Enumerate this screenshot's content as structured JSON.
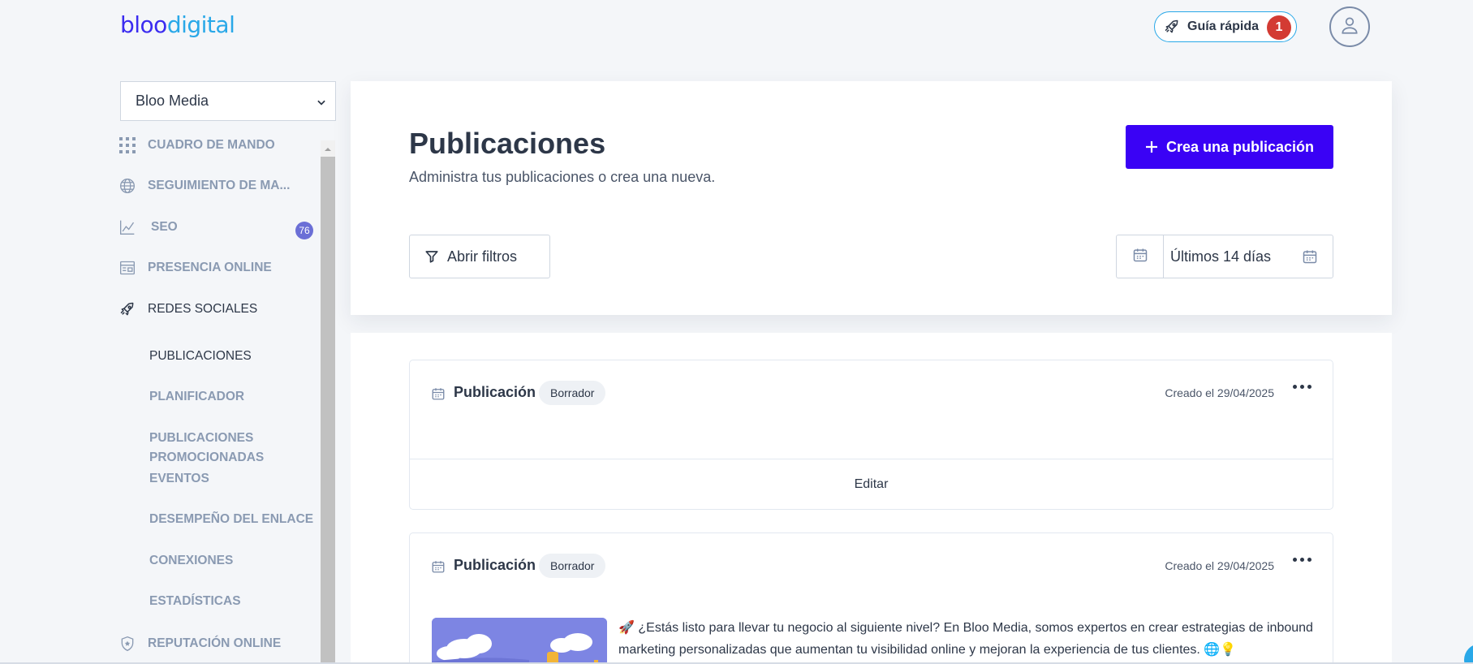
{
  "logo": {
    "part1": "bloo",
    "part2": "digital"
  },
  "topbar": {
    "guide_label": "Guía rápida",
    "guide_badge": "1",
    "avatar_icon": "user-icon"
  },
  "sidebar": {
    "account": "Bloo Media",
    "items": [
      {
        "label": "CUADRO DE MANDO",
        "icon": "grid-icon"
      },
      {
        "label": "SEGUIMIENTO DE MA...",
        "icon": "globe-icon"
      },
      {
        "label": "SEO",
        "icon": "chart-line-icon",
        "badge": "76"
      },
      {
        "label": "PRESENCIA ONLINE",
        "icon": "listing-icon"
      },
      {
        "label": "REDES SOCIALES",
        "icon": "rocket-icon"
      }
    ],
    "sub_items": [
      {
        "label": "PUBLICACIONES"
      },
      {
        "label": "PLANIFICADOR"
      },
      {
        "label": "PUBLICACIONES PROMOCIONADAS"
      },
      {
        "label": "EVENTOS"
      },
      {
        "label": "DESEMPEÑO DEL ENLACE"
      },
      {
        "label": "CONEXIONES"
      },
      {
        "label": "ESTADÍSTICAS"
      }
    ],
    "reputation": {
      "label": "REPUTACIÓN ONLINE",
      "icon": "shield-icon"
    }
  },
  "header": {
    "title": "Publicaciones",
    "subtitle": "Administra tus publicaciones o crea una nueva.",
    "create_label": "Crea una publicación",
    "filters_label": "Abrir filtros",
    "date_range": "Últimos 14 días"
  },
  "posts": [
    {
      "title": "Publicación",
      "status": "Borrador",
      "created": "Creado el 29/04/2025",
      "action": "Editar"
    },
    {
      "title": "Publicación",
      "status": "Borrador",
      "created": "Creado el 29/04/2025",
      "text": "🚀 ¿Estás listo para llevar tu negocio al siguiente nivel? En Bloo Media, somos expertos en crear estrategias de inbound marketing personalizadas que aumentan tu visibilidad online y mejoran la experiencia de tus clientes. 🌐💡"
    }
  ],
  "colors": {
    "primary": "#3a02f5",
    "accent": "#29a8e8",
    "badge_red": "#d33b33",
    "nav_muted": "#8a9ab2"
  }
}
